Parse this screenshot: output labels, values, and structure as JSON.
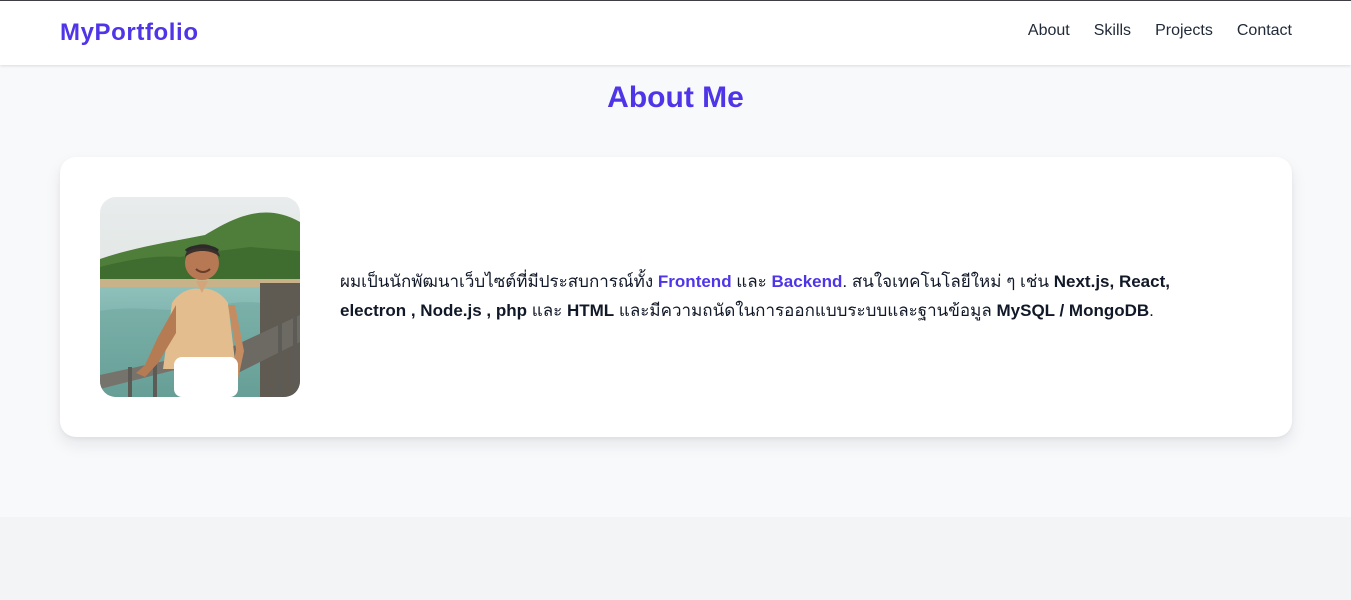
{
  "header": {
    "logo": "MyPortfolio",
    "nav": [
      {
        "label": "About"
      },
      {
        "label": "Skills"
      },
      {
        "label": "Projects"
      },
      {
        "label": "Contact"
      }
    ]
  },
  "about": {
    "title": "About Me",
    "photo_icon": "profile-photo",
    "bio": {
      "p1": "ผมเป็นนักพัฒนาเว็บไซต์ที่มีประสบการณ์ทั้ง ",
      "frontend": "Frontend",
      "p2": " และ ",
      "backend": "Backend",
      "p3": ". สนใจเทคโนโลยีใหม่ ๆ เช่น ",
      "tech": "Next.js, React, electron , Node.js , php",
      "p4": " และ ",
      "html": "HTML",
      "p5": " และมีความถนัดในการออกแบบระบบและฐานข้อมูล ",
      "db": "MySQL / MongoDB",
      "p6": "."
    }
  },
  "colors": {
    "accent": "#4f35e8",
    "page_bg": "#f8f9fb",
    "footer_bg": "#f3f4f6"
  }
}
